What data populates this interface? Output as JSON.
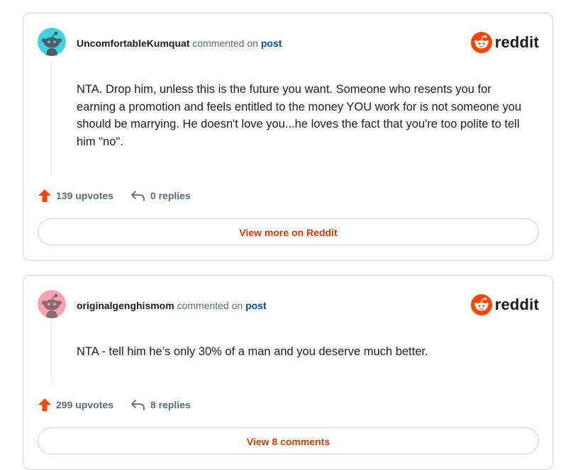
{
  "posts": [
    {
      "username": "UncomfortableKumquat",
      "commented_on": "commented on",
      "post_link": "post",
      "brand": "reddit",
      "avatar_color": "#3dd3e0",
      "body": "NTA. Drop him, unless this is the future you want. Someone who resents you for earning a promotion and feels entitled to the money YOU work for is not someone you should be marrying. He doesn't love you...he loves the fact that you're too polite to tell him \"no\".",
      "upvotes": "139 upvotes",
      "replies": "0 replies",
      "button": "View more on Reddit"
    },
    {
      "username": "originalgenghismom",
      "commented_on": "commented on",
      "post_link": "post",
      "brand": "reddit",
      "avatar_color": "#f5a3b0",
      "body": "NTA - tell him he’s only 30% of a man and you deserve much better.",
      "upvotes": "299 upvotes",
      "replies": "8 replies",
      "button": "View 8 comments"
    }
  ],
  "colors": {
    "accent": "#d93900",
    "upvote": "#ff4500",
    "link": "#0a49a6"
  },
  "icons": [
    "snoo-avatar-icon",
    "reddit-logo-icon",
    "upvote-arrow-icon",
    "reply-arrow-icon"
  ]
}
